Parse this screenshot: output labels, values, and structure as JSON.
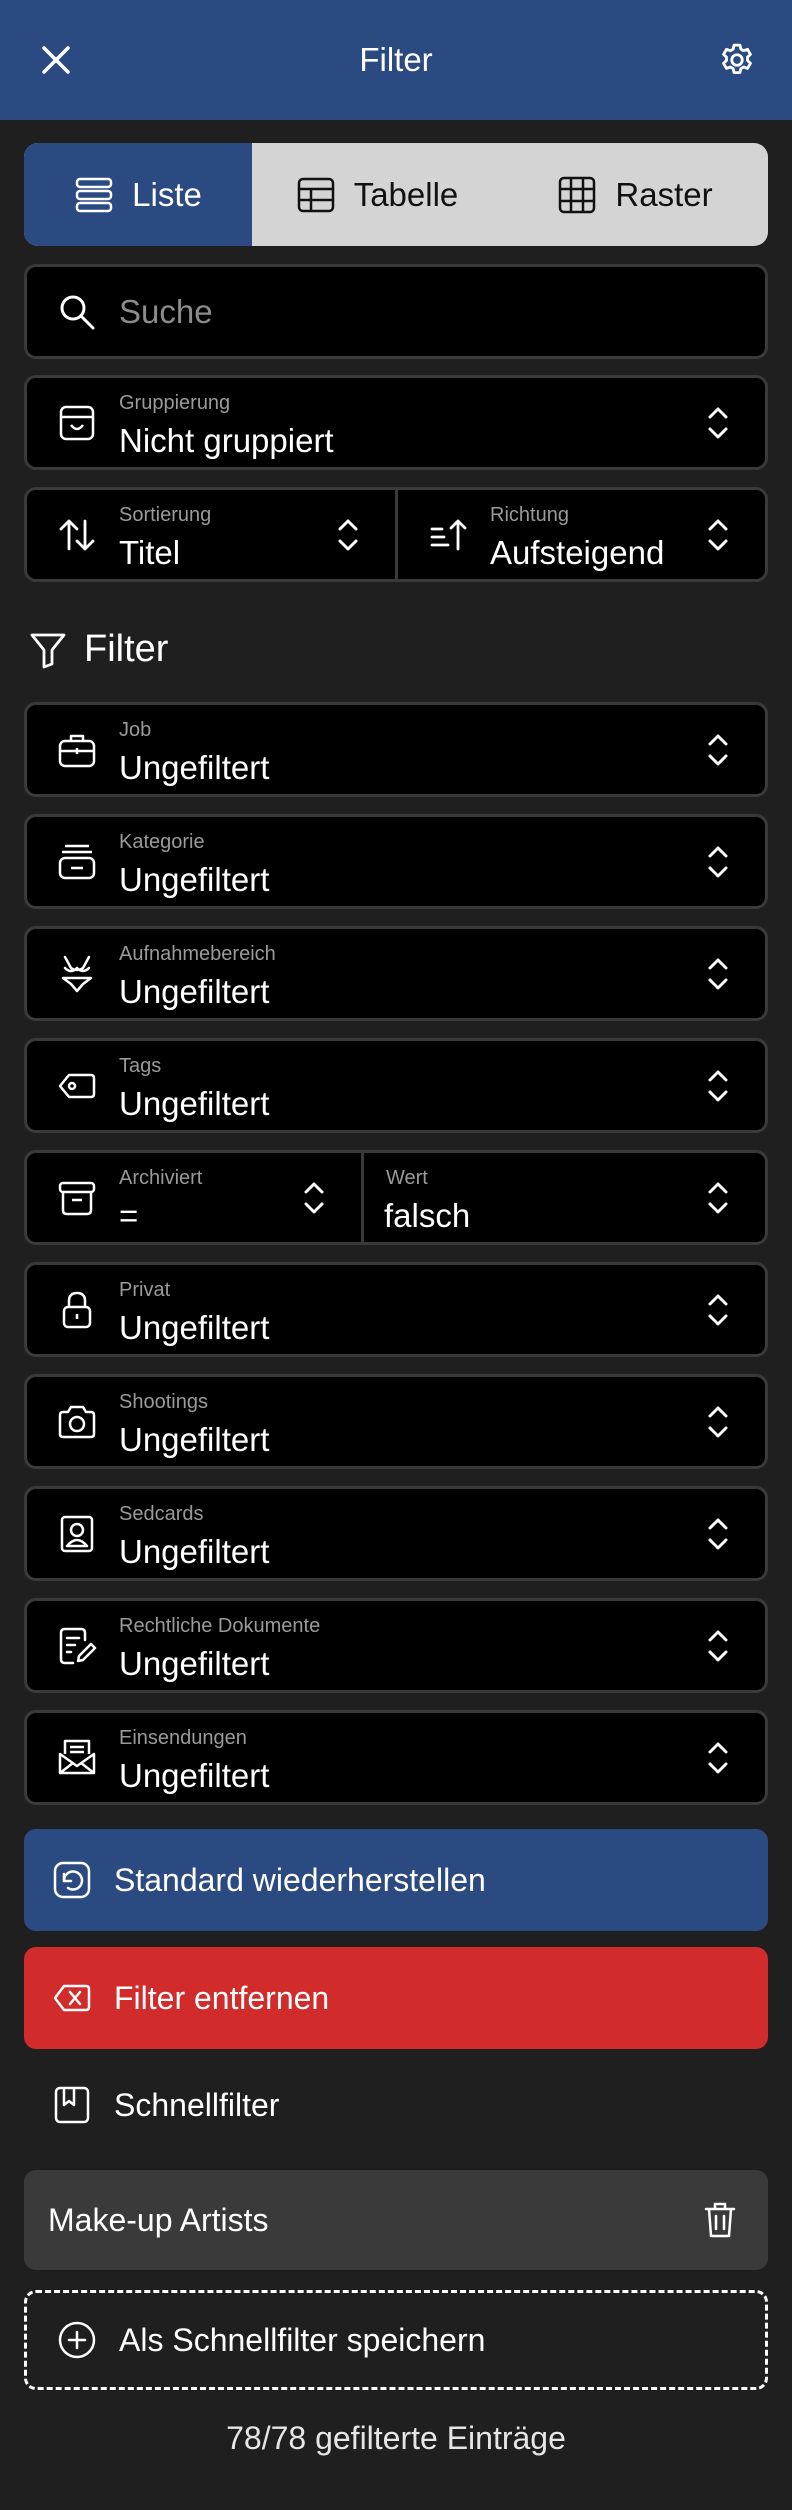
{
  "header": {
    "title": "Filter",
    "close_icon": "close-icon",
    "settings_icon": "gear-icon"
  },
  "view_modes": [
    {
      "label": "Liste",
      "icon": "list-icon",
      "active": true
    },
    {
      "label": "Tabelle",
      "icon": "table-icon",
      "active": false
    },
    {
      "label": "Raster",
      "icon": "grid-icon",
      "active": false
    }
  ],
  "search": {
    "placeholder": "Suche"
  },
  "grouping": {
    "label": "Gruppierung",
    "value": "Nicht gruppiert"
  },
  "sorting": {
    "label": "Sortierung",
    "value": "Titel"
  },
  "direction": {
    "label": "Richtung",
    "value": "Aufsteigend"
  },
  "filter_section": {
    "title": "Filter"
  },
  "filters": {
    "job": {
      "label": "Job",
      "value": "Ungefiltert"
    },
    "kategorie": {
      "label": "Kategorie",
      "value": "Ungefiltert"
    },
    "aufnahmebereich": {
      "label": "Aufnahmebereich",
      "value": "Ungefiltert"
    },
    "tags": {
      "label": "Tags",
      "value": "Ungefiltert"
    },
    "archiviert": {
      "label": "Archiviert",
      "value": "="
    },
    "wert": {
      "label": "Wert",
      "value": "falsch"
    },
    "privat": {
      "label": "Privat",
      "value": "Ungefiltert"
    },
    "shootings": {
      "label": "Shootings",
      "value": "Ungefiltert"
    },
    "sedcards": {
      "label": "Sedcards",
      "value": "Ungefiltert"
    },
    "rechtliche_dokumente": {
      "label": "Rechtliche Dokumente",
      "value": "Ungefiltert"
    },
    "einsendungen": {
      "label": "Einsendungen",
      "value": "Ungefiltert"
    }
  },
  "actions": {
    "restore": "Standard wiederherstellen",
    "remove": "Filter entfernen"
  },
  "quickfilter": {
    "title": "Schnellfilter",
    "presets": [
      "Make-up Artists"
    ],
    "save_label": "Als Schnellfilter speichern"
  },
  "footer": {
    "count_text": "78/78 gefilterte Einträge"
  },
  "colors": {
    "accent": "#2c4a82",
    "danger": "#d22b2b",
    "background": "#1f1f1f",
    "field": "#000000"
  }
}
